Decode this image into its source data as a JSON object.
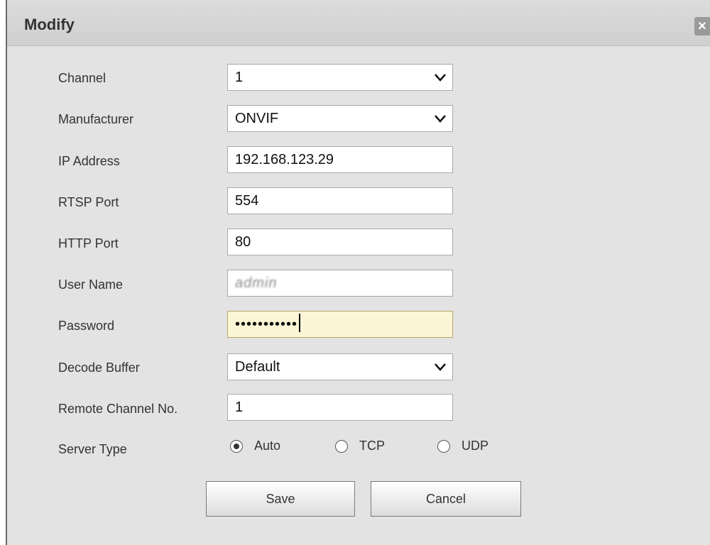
{
  "dialog": {
    "title": "Modify",
    "close_icon": "close-icon"
  },
  "form": {
    "channel": {
      "label": "Channel",
      "value": "1"
    },
    "manufacturer": {
      "label": "Manufacturer",
      "value": "ONVIF"
    },
    "ip_address": {
      "label": "IP Address",
      "value": "192.168.123.29"
    },
    "rtsp_port": {
      "label": "RTSP Port",
      "value": "554"
    },
    "http_port": {
      "label": "HTTP Port",
      "value": "80"
    },
    "user_name": {
      "label": "User Name",
      "value": "admin"
    },
    "password": {
      "label": "Password",
      "value": "•••••••••••"
    },
    "decode_buffer": {
      "label": "Decode Buffer",
      "value": "Default"
    },
    "remote_channel": {
      "label": "Remote Channel No.",
      "value": "1"
    },
    "server_type": {
      "label": "Server Type",
      "options": [
        "Auto",
        "TCP",
        "UDP"
      ],
      "selected": "Auto"
    }
  },
  "buttons": {
    "save": "Save",
    "cancel": "Cancel"
  },
  "colors": {
    "dialog_bg": "#e3e3e3",
    "password_bg": "#fdf6d6"
  }
}
